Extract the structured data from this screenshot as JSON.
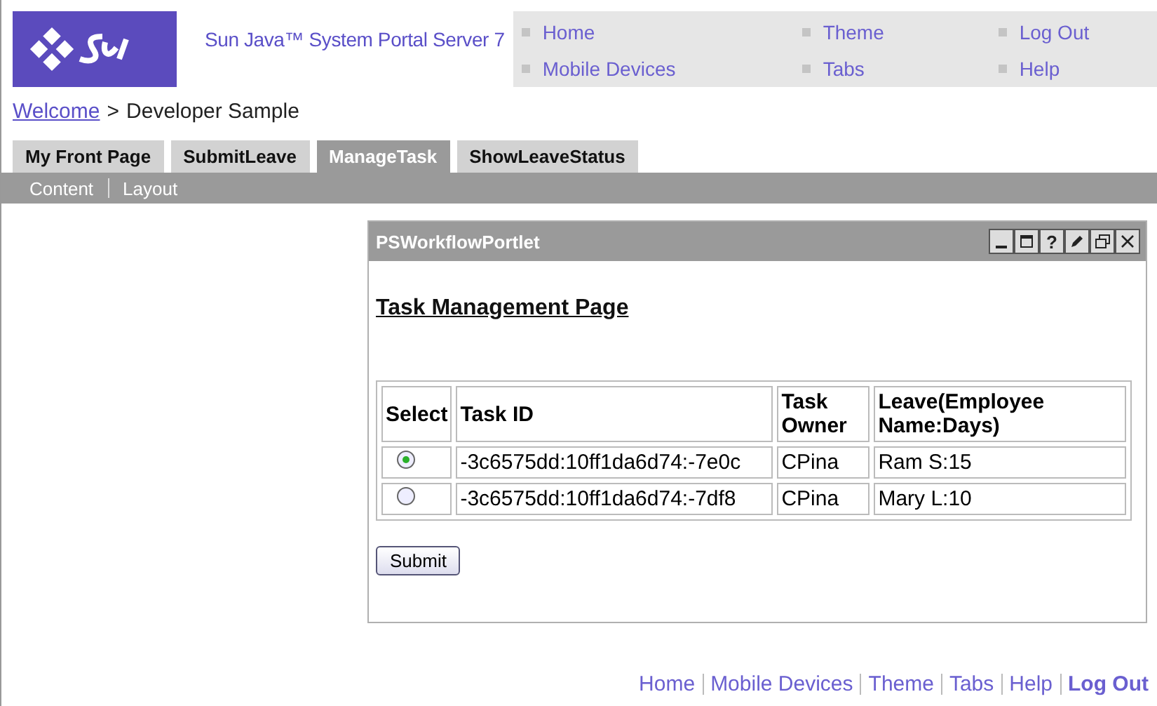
{
  "header": {
    "title": "Sun Java™ System Portal Server 7",
    "nav": [
      {
        "label": "Home"
      },
      {
        "label": "Theme"
      },
      {
        "label": "Log Out"
      },
      {
        "label": "Mobile Devices"
      },
      {
        "label": "Tabs"
      },
      {
        "label": "Help"
      }
    ]
  },
  "breadcrumb": {
    "link": "Welcome",
    "separator": ">",
    "current": "Developer Sample"
  },
  "tabs": [
    {
      "label": "My Front Page",
      "selected": false
    },
    {
      "label": "SubmitLeave",
      "selected": false
    },
    {
      "label": "ManageTask",
      "selected": true
    },
    {
      "label": "ShowLeaveStatus",
      "selected": false
    }
  ],
  "subtabs": [
    {
      "label": "Content"
    },
    {
      "label": "Layout"
    }
  ],
  "portlet": {
    "title": "PSWorkflowPortlet",
    "controls": [
      {
        "kind": "minimize"
      },
      {
        "kind": "maximize"
      },
      {
        "kind": "help",
        "label": "?"
      },
      {
        "kind": "edit"
      },
      {
        "kind": "restore"
      },
      {
        "kind": "close"
      }
    ],
    "heading": "Task Management Page",
    "table": {
      "columns": [
        "Select",
        "Task ID",
        "Task Owner",
        "Leave(Employee Name:Days)"
      ],
      "rows": [
        {
          "selected": true,
          "task_id": "-3c6575dd:10ff1da6d74:-7e0c",
          "task_owner": "CPina",
          "leave": "Ram S:15"
        },
        {
          "selected": false,
          "task_id": "-3c6575dd:10ff1da6d74:-7df8",
          "task_owner": "CPina",
          "leave": "Mary L:10"
        }
      ]
    },
    "submit": "Submit"
  },
  "footer": [
    {
      "label": "Home",
      "emphasized": false
    },
    {
      "label": "Mobile Devices",
      "emphasized": false
    },
    {
      "label": "Theme",
      "emphasized": false
    },
    {
      "label": "Tabs",
      "emphasized": false
    },
    {
      "label": "Help",
      "emphasized": false
    },
    {
      "label": "Log Out",
      "emphasized": true
    }
  ]
}
